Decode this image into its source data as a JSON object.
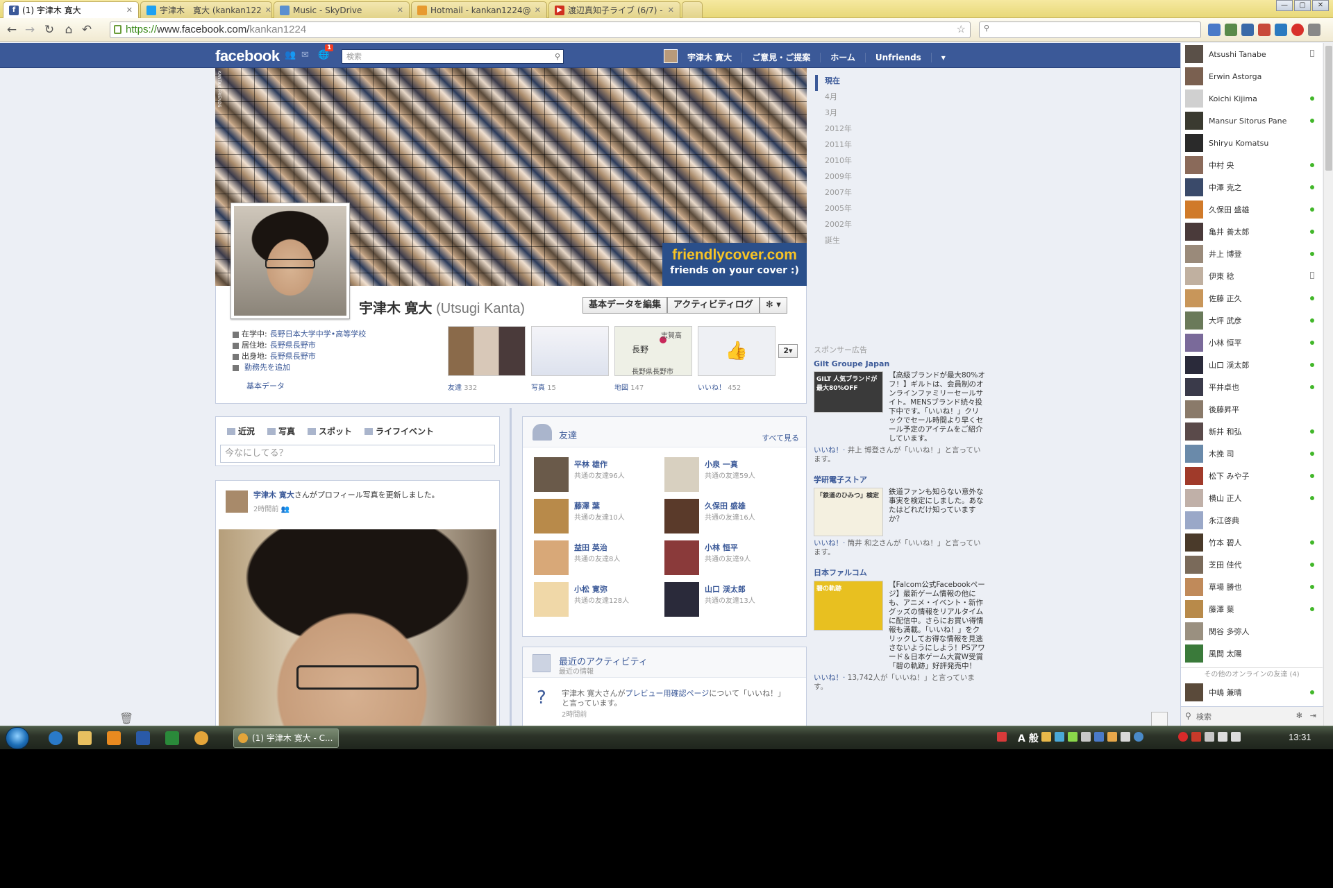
{
  "browser": {
    "tabs": [
      {
        "label": "(1) 宇津木 寛大",
        "active": true,
        "fav_color": "#3b5998"
      },
      {
        "label": "宇津木　寛大 (kankan122",
        "fav_color": "#1da1f2"
      },
      {
        "label": "Music - SkyDrive",
        "fav_color": "#5a8fd0"
      },
      {
        "label": "Hotmail - kankan1224@",
        "fav_color": "#e79a30"
      },
      {
        "label": "渡辺真知子ライブ (6/7) -",
        "fav_color": "#d03020"
      }
    ],
    "url_scheme": "https://",
    "url_host": "www.facebook.com/",
    "url_path": "kankan1224"
  },
  "fb": {
    "logo": "facebook",
    "notif_count": "1",
    "search_placeholder": "検索",
    "nav": {
      "user": "宇津木 寛大",
      "feedback": "ご意見・ご提案",
      "home": "ホーム",
      "unfriends": "Unfriends"
    }
  },
  "cover": {
    "brand_main": "friendlycover.com",
    "brand_sub": "friends on your cover :)",
    "side_label": "KANTA's FRIENDS"
  },
  "profile": {
    "name": "宇津木 寛大",
    "alt_name": "(Utsugi Kanta)",
    "btn_edit": "基本データを編集",
    "btn_log": "アクティビティログ",
    "btn_gear": "✻ ▾",
    "info": [
      {
        "label": "在学中: ",
        "value": "長野日本大学中学•高等学校"
      },
      {
        "label": "居住地: ",
        "value": "長野県長野市"
      },
      {
        "label": "出身地: ",
        "value": "長野県長野市"
      },
      {
        "label": "",
        "value": "勤務先を追加"
      }
    ],
    "basic_data": "基本データ",
    "apps": [
      {
        "label": "友達",
        "count": "332"
      },
      {
        "label": "写真",
        "count": "15"
      },
      {
        "label": "地図",
        "count": "147"
      },
      {
        "label": "いいね！",
        "count": "452"
      }
    ],
    "map_city": "長野",
    "map_pref": "長野県長野市",
    "map_extra": "志賀高",
    "more_apps": "2▾"
  },
  "timeline_nav": [
    "現在",
    "4月",
    "3月",
    "2012年",
    "2011年",
    "2010年",
    "2009年",
    "2007年",
    "2005年",
    "2002年",
    "誕生"
  ],
  "composer": {
    "tabs": [
      "近況",
      "写真",
      "スポット",
      "ライフイベント"
    ],
    "placeholder": "今なにしてる？"
  },
  "story": {
    "actor": "宇津木 寛大",
    "text_mid": "さんがプロフィール写真を更新しました。",
    "time": "2時間前"
  },
  "friends_box": {
    "title": "友達",
    "see_all": "すべて見る",
    "items": [
      {
        "name": "平林 雄作",
        "mutual": "共通の友達96人",
        "color": "#6a5a4a"
      },
      {
        "name": "小泉 一真",
        "mutual": "共通の友達59人",
        "color": "#d8d0c0"
      },
      {
        "name": "藤澤 葉",
        "mutual": "共通の友達10人",
        "color": "#b88a4a"
      },
      {
        "name": "久保田 盛雄",
        "mutual": "共通の友達16人",
        "color": "#5a3a2a"
      },
      {
        "name": "益田 英治",
        "mutual": "共通の友達8人",
        "color": "#d8a878"
      },
      {
        "name": "小林 恒平",
        "mutual": "共通の友達9人",
        "color": "#8a3a3a"
      },
      {
        "name": "小松 寛弥",
        "mutual": "共通の友達128人",
        "color": "#f0d8a8"
      },
      {
        "name": "山口 渓太郎",
        "mutual": "共通の友達13人",
        "color": "#2a2a3a"
      }
    ]
  },
  "activity": {
    "title": "最近のアクティビティ",
    "sub": "最近の情報",
    "text_pre": "宇津木 寛大さんが",
    "text_link": "プレビュー用確認ページ",
    "text_post": "について「いいね！」と言っています。",
    "time": "2時間前"
  },
  "ads": {
    "header": "スポンサー広告",
    "items": [
      {
        "title": "Gilt Groupe Japan",
        "body": "【高級ブランドが最大80%オフ！】ギルトは、会員制のオンラインファミリーセールサイト。MENSブランド続々投下中です。「いいね！」クリックでセール時間より早くセール予定のアイテムをご紹介しています。",
        "like_pre": "いいね！· ",
        "like_who": "井上 博登",
        "like_post": "さんが「いいね！」と言っています。",
        "img_text": "GILT 人気ブランドが最大80%OFF",
        "img_color": "#3a3a3a"
      },
      {
        "title": "学研電子ストア",
        "body": "鉄道ファンも知らない意外な事実を検定にしました。あなたはどれだけ知っていますか？",
        "like_pre": "いいね！· ",
        "like_who": "筒井 和之",
        "like_post": "さんが「いいね！」と言っています。",
        "img_text": "「鉄道のひみつ」検定",
        "img_color": "#f4f0e0"
      },
      {
        "title": "日本ファルコム",
        "body": "【Falcom公式Facebookページ】最新ゲーム情報の他にも、アニメ・イベント・新作グッズの情報をリアルタイムに配信中。さらにお買い得情報も満載。「いいね！」をクリックしてお得な情報を見逃さないようにしよう！PSアワード＆日本ゲーム大賞W受賞「碧の軌跡」好評発売中！",
        "like_pre": "いいね！· ",
        "like_who": "13,742人",
        "like_post": "が「いいね！」と言っています。",
        "img_text": "碧の軌跡",
        "img_color": "#e8c020"
      }
    ]
  },
  "chat": {
    "friends": [
      {
        "name": "Atsushi Tanabe",
        "status": "mobile",
        "color": "#5a5048"
      },
      {
        "name": "Erwin Astorga",
        "status": "none",
        "color": "#7a6050"
      },
      {
        "name": "Koichi Kijima",
        "status": "online",
        "color": "#d0d0d0"
      },
      {
        "name": "Mansur Sitorus Pane",
        "status": "online",
        "color": "#3a3a30"
      },
      {
        "name": "Shiryu Komatsu",
        "status": "none",
        "color": "#2a2a2a"
      },
      {
        "name": "中村 央",
        "status": "online",
        "color": "#8a6a5a"
      },
      {
        "name": "中澤 克之",
        "status": "online",
        "color": "#3a4a6a"
      },
      {
        "name": "久保田 盛雄",
        "status": "online",
        "color": "#d07a2a"
      },
      {
        "name": "亀井 善太郎",
        "status": "online",
        "color": "#4a3a3a"
      },
      {
        "name": "井上 博登",
        "status": "online",
        "color": "#9a8a7a"
      },
      {
        "name": "伊東 稔",
        "status": "mobile",
        "color": "#c0b0a0"
      },
      {
        "name": "佐藤 正久",
        "status": "online",
        "color": "#c8965a"
      },
      {
        "name": "大坪 武彦",
        "status": "online",
        "color": "#6a7a5a"
      },
      {
        "name": "小林 恒平",
        "status": "online",
        "color": "#7a6a9a"
      },
      {
        "name": "山口 渓太郎",
        "status": "online",
        "color": "#2a2a3a"
      },
      {
        "name": "平井卓也",
        "status": "online",
        "color": "#3a3a4a"
      },
      {
        "name": "後藤昇平",
        "status": "none",
        "color": "#8a7a6a"
      },
      {
        "name": "新井 和弘",
        "status": "online",
        "color": "#5a4a4a"
      },
      {
        "name": "木挽 司",
        "status": "online",
        "color": "#6a8aaa"
      },
      {
        "name": "松下 みや子",
        "status": "online",
        "color": "#a03a2a"
      },
      {
        "name": "横山 正人",
        "status": "online",
        "color": "#c0b0a8"
      },
      {
        "name": "永江啓典",
        "status": "none",
        "color": "#9aa8c8"
      },
      {
        "name": "竹本 碧人",
        "status": "online",
        "color": "#4a3a2a"
      },
      {
        "name": "芝田 佳代",
        "status": "online",
        "color": "#7a6a5a"
      },
      {
        "name": "草場 勝也",
        "status": "online",
        "color": "#c08a5a"
      },
      {
        "name": "藤澤 葉",
        "status": "online",
        "color": "#b88a4a"
      },
      {
        "name": "関谷 多弥人",
        "status": "none",
        "color": "#9a9080"
      },
      {
        "name": "風間 太陽",
        "status": "none",
        "color": "#3a7a3a"
      }
    ],
    "other_online": "その他のオンラインの友達 (4)",
    "other_first": "中嶋 兼晴",
    "search": "検索"
  },
  "taskbar": {
    "task_label": "(1) 宇津木 寛大 - C...",
    "ime": "A 般",
    "clock": "13:31"
  }
}
